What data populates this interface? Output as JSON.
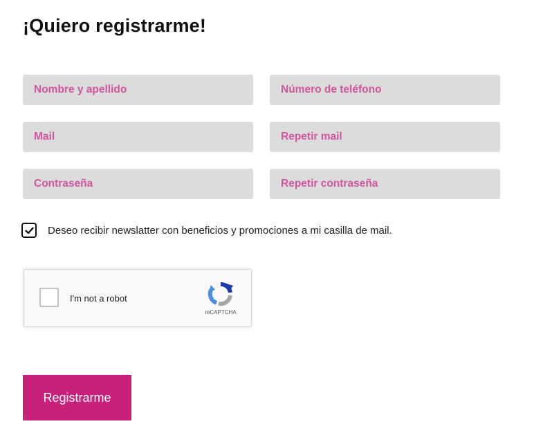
{
  "form": {
    "title": "¡Quiero registrarme!",
    "fields": {
      "full_name": {
        "placeholder": "Nombre y apellido",
        "value": ""
      },
      "phone": {
        "placeholder": "Número de teléfono",
        "value": ""
      },
      "email": {
        "placeholder": "Mail",
        "value": ""
      },
      "email_repeat": {
        "placeholder": "Repetir mail",
        "value": ""
      },
      "password": {
        "placeholder": "Contraseña",
        "value": ""
      },
      "password_repeat": {
        "placeholder": "Repetir contraseña",
        "value": ""
      }
    },
    "newsletter": {
      "checked": true,
      "label": "Deseo recibir newslatter con beneficios y promociones a mi casilla de mail."
    },
    "captcha": {
      "label": "I'm not a robot",
      "brand": "reCAPTCHA",
      "checked": false
    },
    "submit_label": "Registrarme"
  },
  "colors": {
    "accent": "#c8217a",
    "placeholder": "#d2559e",
    "field_background": "#dcdcdc",
    "title": "#111111"
  },
  "icons": {
    "newsletter_checkbox": "checkmark-icon",
    "captcha_logo": "recaptcha-logo-icon"
  }
}
